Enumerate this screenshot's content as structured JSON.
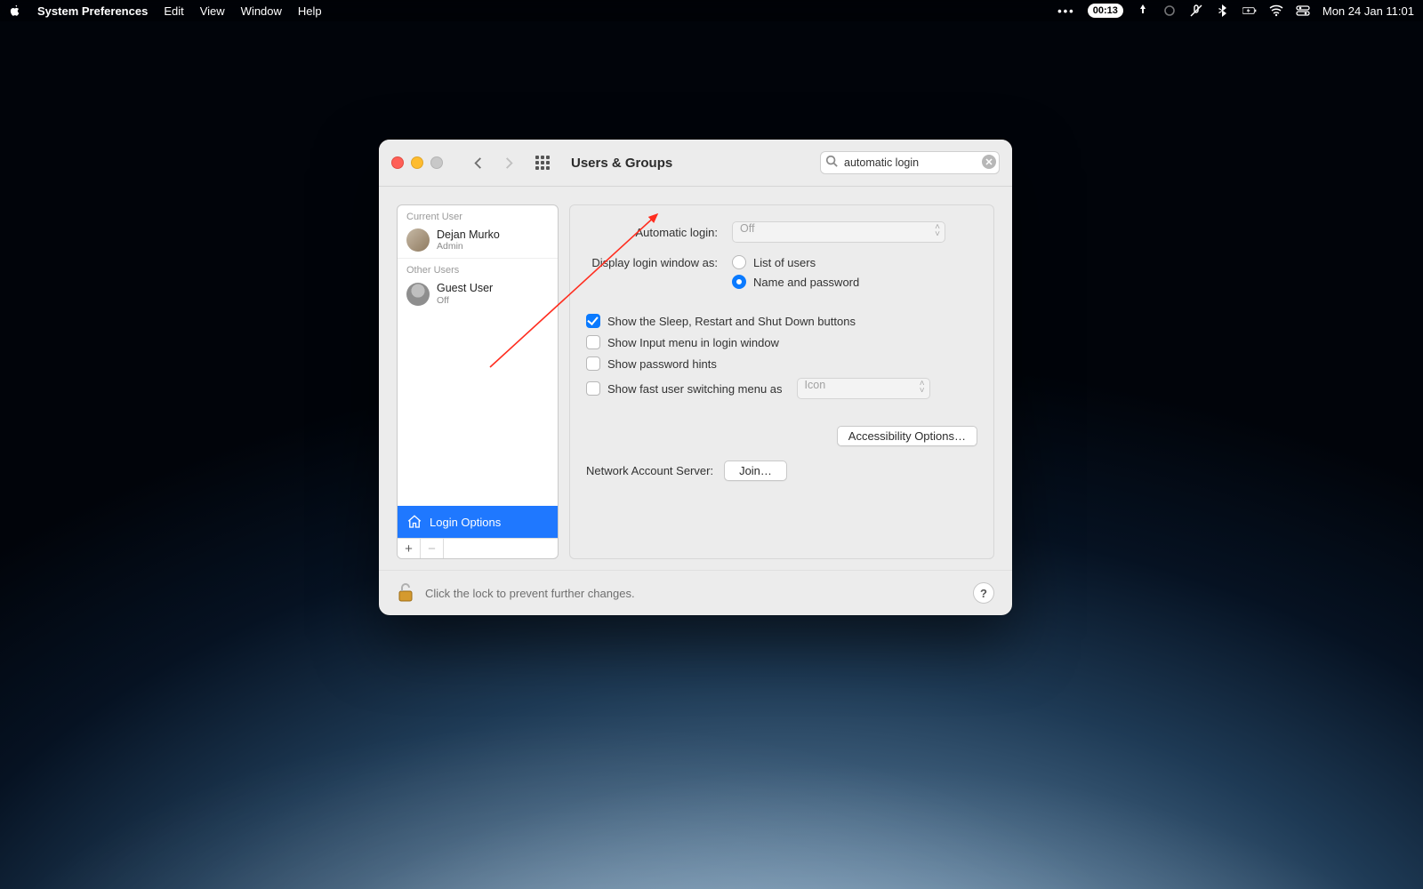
{
  "menubar": {
    "app_name": "System Preferences",
    "items": [
      "Edit",
      "View",
      "Window",
      "Help"
    ],
    "timer_badge": "00:13",
    "clock": "Mon 24 Jan  11:01"
  },
  "window": {
    "title": "Users & Groups",
    "search_value": "automatic login"
  },
  "sidebar": {
    "current_user_header": "Current User",
    "other_users_header": "Other Users",
    "current_user": {
      "name": "Dejan Murko",
      "role": "Admin"
    },
    "other_user": {
      "name": "Guest User",
      "role": "Off"
    },
    "login_options_label": "Login Options"
  },
  "pane": {
    "auto_login_label": "Automatic login:",
    "auto_login_value": "Off",
    "display_login_label": "Display login window as:",
    "radio_list": "List of users",
    "radio_namepw": "Name and password",
    "chk_sleep": "Show the Sleep, Restart and Shut Down buttons",
    "chk_input": "Show Input menu in login window",
    "chk_hints": "Show password hints",
    "chk_fastswitch": "Show fast user switching menu as",
    "fastswitch_value": "Icon",
    "accessibility_btn": "Accessibility Options…",
    "net_label": "Network Account Server:",
    "join_btn": "Join…"
  },
  "footer": {
    "lock_text": "Click the lock to prevent further changes."
  }
}
